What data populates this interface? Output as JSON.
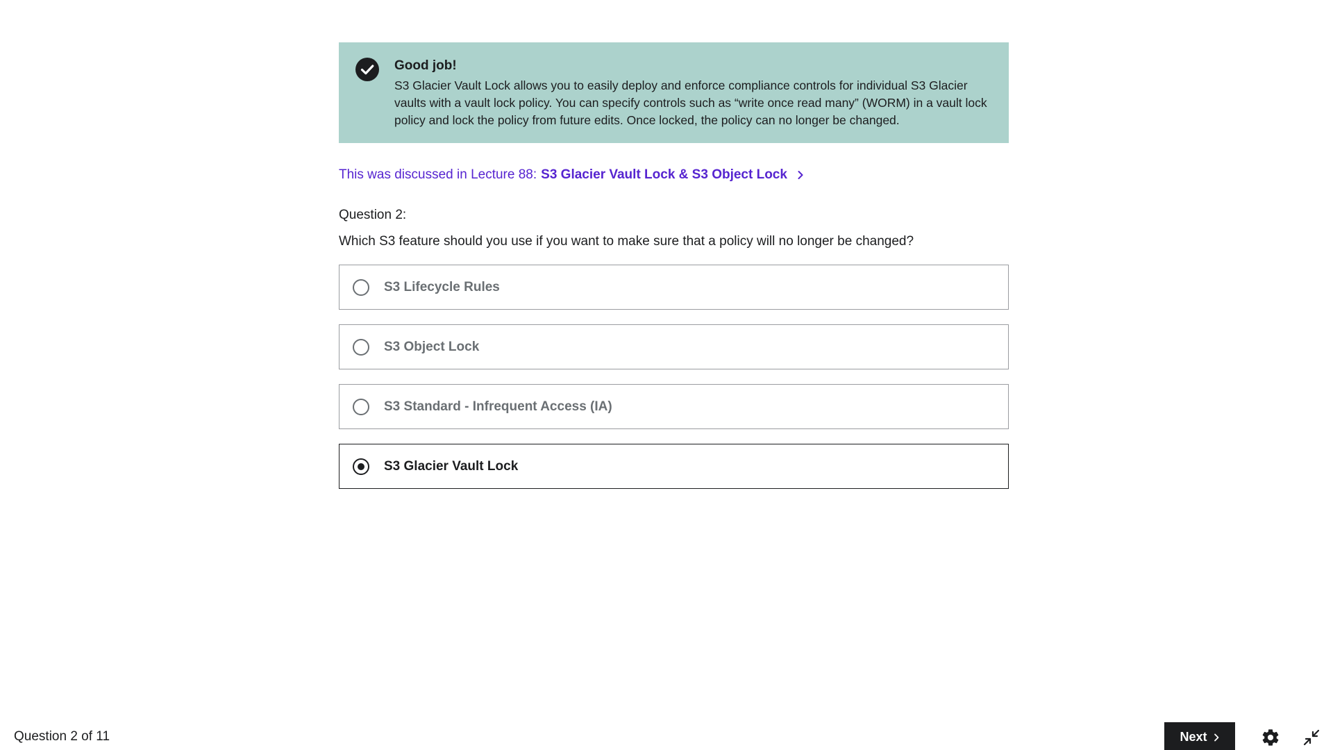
{
  "feedback": {
    "icon": "check-circle-icon",
    "title": "Good job!",
    "text": "S3 Glacier Vault Lock allows you to easily deploy and enforce compliance controls for individual S3 Glacier vaults with a vault lock policy. You can specify controls such as “write once read many” (WORM) in a vault lock policy and lock the policy from future edits. Once locked, the policy can no longer be changed.",
    "background_color": "#acd2cc"
  },
  "lecture": {
    "prefix": "This was discussed in Lecture 88:",
    "link_text": "S3 Glacier Vault Lock & S3 Object Lock",
    "icon": "chevron-right-icon",
    "color": "#5624d0"
  },
  "question": {
    "label": "Question 2:",
    "text": "Which S3 feature should you use if you want to make sure that a policy will no longer be changed?",
    "options": [
      {
        "label": "S3 Lifecycle Rules",
        "selected": false
      },
      {
        "label": "S3 Object Lock",
        "selected": false
      },
      {
        "label": "S3 Standard - Infrequent Access (IA)",
        "selected": false
      },
      {
        "label": "S3 Glacier Vault Lock",
        "selected": true
      }
    ]
  },
  "footer": {
    "progress": "Question 2 of 11",
    "next_label": "Next",
    "next_icon": "chevron-right-icon",
    "settings_icon": "gear-icon",
    "collapse_icon": "collapse-icon"
  }
}
